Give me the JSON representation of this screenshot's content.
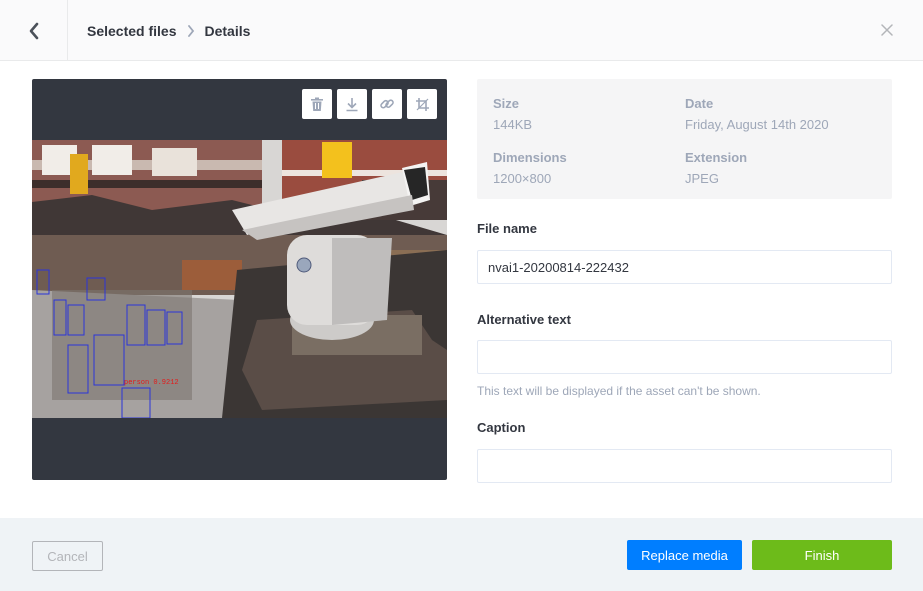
{
  "header": {
    "crumb_1": "Selected files",
    "crumb_2": "Details"
  },
  "info": {
    "size_label": "Size",
    "size_value": "144KB",
    "date_label": "Date",
    "date_value": "Friday, August 14th 2020",
    "dimensions_label": "Dimensions",
    "dimensions_value": "1200×800",
    "extension_label": "Extension",
    "extension_value": "JPEG"
  },
  "form": {
    "file_name_label": "File name",
    "file_name_value": "nvai1-20200814-222432",
    "alt_label": "Alternative text",
    "alt_value": "",
    "alt_hint": "This text will be displayed if the asset can't be shown.",
    "caption_label": "Caption",
    "caption_value": ""
  },
  "detections": [
    "person 0.9212"
  ],
  "footer": {
    "cancel_label": "Cancel",
    "replace_label": "Replace media",
    "finish_label": "Finish"
  },
  "icons": [
    "chevron-left-icon",
    "chevron-right-icon",
    "close-icon",
    "trash-icon",
    "download-icon",
    "link-icon",
    "crop-icon"
  ],
  "colors": {
    "primary": "#007eff",
    "success": "#6dbb1a",
    "preview_bg": "#333740"
  }
}
